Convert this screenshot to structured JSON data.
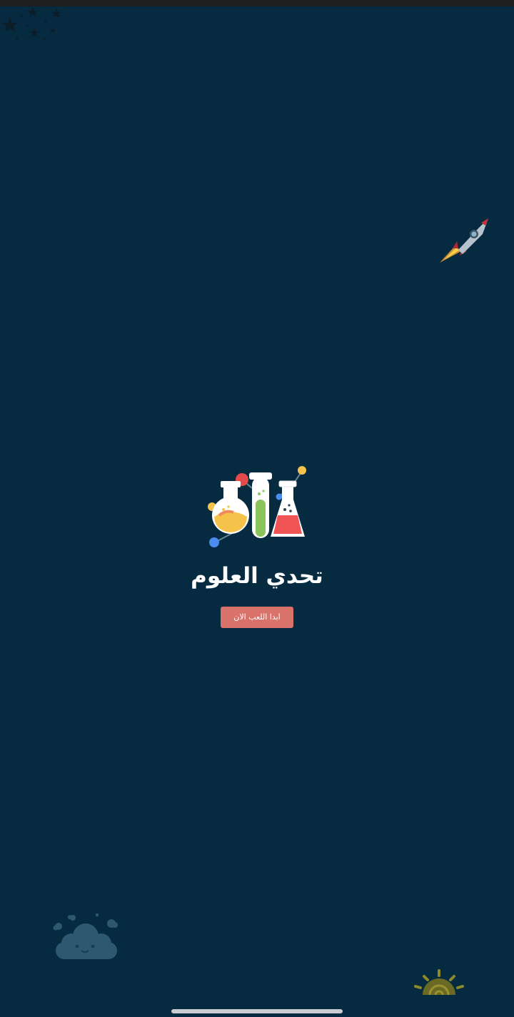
{
  "app": {
    "title": "تحدي العلوم",
    "start_button_label": "ابدا اللعب الان"
  },
  "icons": {
    "logo": "science-flasks-icon",
    "stars": "stars-icon",
    "rocket": "rocket-icon",
    "cloud": "cloud-icon",
    "sun": "sun-icon"
  },
  "colors": {
    "background": "#062b41",
    "button": "#d9726a",
    "title": "#ffffff"
  }
}
